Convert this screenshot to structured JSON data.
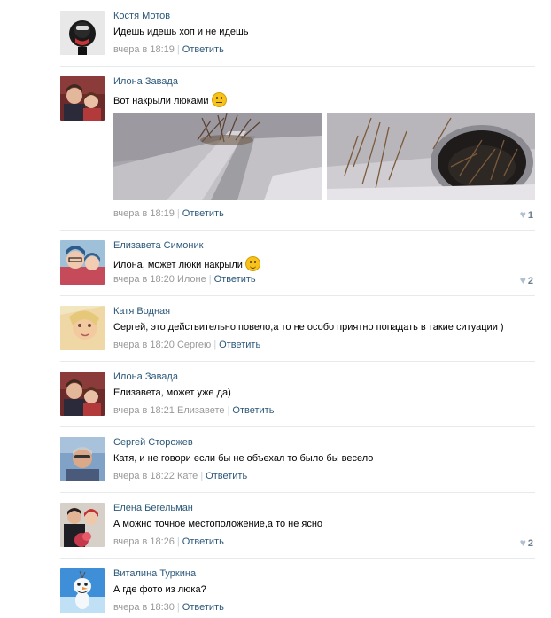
{
  "comments": [
    {
      "author": "Костя Мотов",
      "text": "Идешь идешь хоп и не идешь",
      "time": "вчера в 18:19",
      "reply_to": "",
      "reply_label": "Ответить",
      "likes": ""
    },
    {
      "author": "Илона Завада",
      "text": "Вот накрыли люками",
      "emoji": "neutral-face-emoji",
      "time": "вчера в 18:19",
      "reply_to": "",
      "reply_label": "Ответить",
      "likes": "1"
    },
    {
      "author": "Елизавета Симоник",
      "text": "Илона, может люки накрыли",
      "emoji": "wink-face-emoji",
      "time": "вчера в 18:20",
      "reply_to": "Илоне",
      "reply_label": "Ответить",
      "likes": "2"
    },
    {
      "author": "Катя Водная",
      "text": "Сергей, это действительно повело,а то не особо приятно попадать в такие ситуации )",
      "time": "вчера в 18:20",
      "reply_to": "Сергею",
      "reply_label": "Ответить",
      "likes": ""
    },
    {
      "author": "Илона Завада",
      "text": "Елизавета, может уже да)",
      "time": "вчера в 18:21",
      "reply_to": "Елизавете",
      "reply_label": "Ответить",
      "likes": ""
    },
    {
      "author": "Сергей Сторожев",
      "text": "Катя, и не говори если бы не объехал то было бы весело",
      "time": "вчера в 18:22",
      "reply_to": "Кате",
      "reply_label": "Ответить",
      "likes": ""
    },
    {
      "author": "Елена Бегельман",
      "text": "А можно точное местоположение,а то не ясно",
      "time": "вчера в 18:26",
      "reply_to": "",
      "reply_label": "Ответить",
      "likes": "2"
    },
    {
      "author": "Виталина Туркина",
      "text": "А где фото из люка?",
      "time": "вчера в 18:30",
      "reply_to": "",
      "reply_label": "Ответить",
      "likes": ""
    }
  ],
  "icons": {
    "like": "heart-icon"
  },
  "colors": {
    "link": "#2b587a",
    "meta": "#999999",
    "divider": "#e7eaed",
    "like_count": "#6a7d90"
  }
}
